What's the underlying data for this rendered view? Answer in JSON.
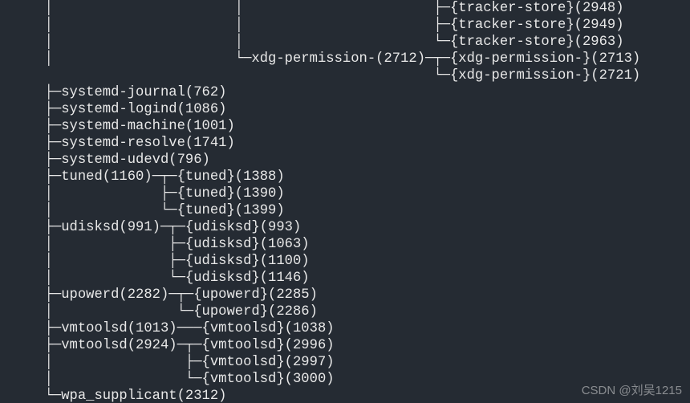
{
  "watermark": "CSDN @刘吴1215",
  "tree": {
    "root_continuation": {
      "tracker_store": [
        {
          "name": "{tracker-store}",
          "pid": 2948
        },
        {
          "name": "{tracker-store}",
          "pid": 2949
        },
        {
          "name": "{tracker-store}",
          "pid": 2963
        }
      ],
      "xdg_permission": {
        "name": "xdg-permission-",
        "pid": 2712,
        "children": [
          {
            "name": "{xdg-permission-}",
            "pid": 2713
          },
          {
            "name": "{xdg-permission-}",
            "pid": 2721
          }
        ]
      }
    },
    "children": [
      {
        "name": "systemd-journal",
        "pid": 762
      },
      {
        "name": "systemd-logind",
        "pid": 1086
      },
      {
        "name": "systemd-machine",
        "pid": 1001
      },
      {
        "name": "systemd-resolve",
        "pid": 1741
      },
      {
        "name": "systemd-udevd",
        "pid": 796
      },
      {
        "name": "tuned",
        "pid": 1160,
        "threads": [
          {
            "name": "{tuned}",
            "pid": 1388
          },
          {
            "name": "{tuned}",
            "pid": 1390
          },
          {
            "name": "{tuned}",
            "pid": 1399
          }
        ]
      },
      {
        "name": "udisksd",
        "pid": 991,
        "threads": [
          {
            "name": "{udisksd}",
            "pid": 993
          },
          {
            "name": "{udisksd}",
            "pid": 1063
          },
          {
            "name": "{udisksd}",
            "pid": 1100
          },
          {
            "name": "{udisksd}",
            "pid": 1146
          }
        ]
      },
      {
        "name": "upowerd",
        "pid": 2282,
        "threads": [
          {
            "name": "{upowerd}",
            "pid": 2285
          },
          {
            "name": "{upowerd}",
            "pid": 2286
          }
        ]
      },
      {
        "name": "vmtoolsd",
        "pid": 1013,
        "threads": [
          {
            "name": "{vmtoolsd}",
            "pid": 1038
          }
        ]
      },
      {
        "name": "vmtoolsd",
        "pid": 2924,
        "threads": [
          {
            "name": "{vmtoolsd}",
            "pid": 2996
          },
          {
            "name": "{vmtoolsd}",
            "pid": 2997
          },
          {
            "name": "{vmtoolsd}",
            "pid": 3000
          }
        ]
      },
      {
        "name": "wpa_supplicant",
        "pid": 2312
      }
    ]
  }
}
